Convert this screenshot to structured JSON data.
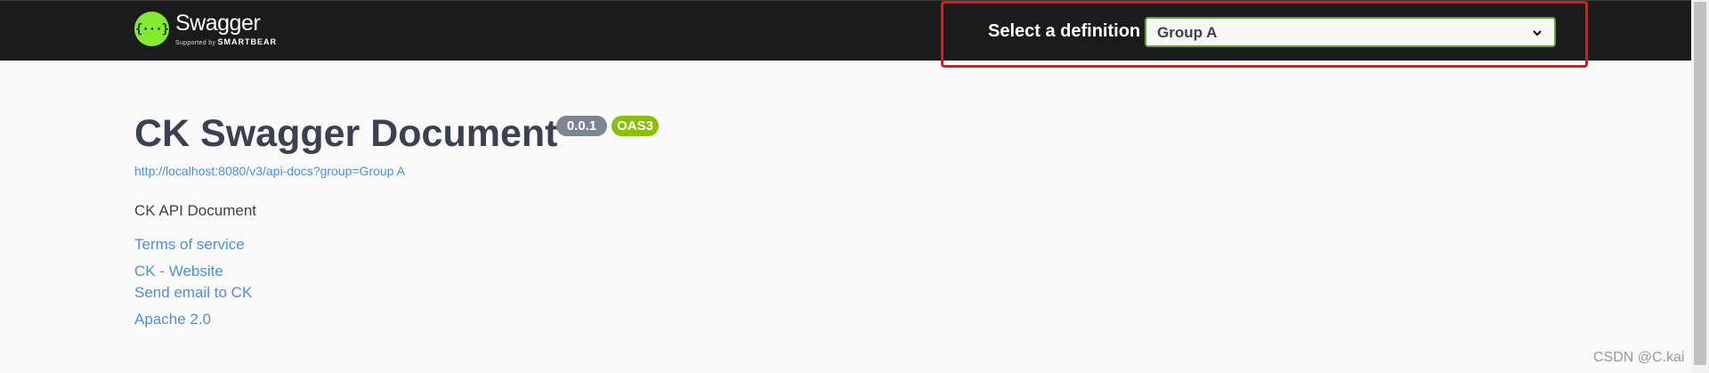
{
  "header": {
    "logo_name": "Swagger",
    "logo_supported_by": "Supported by",
    "logo_smartbear": "SMARTBEAR",
    "logo_glyph": "{···}",
    "select_label": "Select a definition",
    "selected_definition": "Group A"
  },
  "info": {
    "title": "CK Swagger Document",
    "version_badge": "0.0.1",
    "oas_badge": "OAS3",
    "spec_url": "http://localhost:8080/v3/api-docs?group=Group A",
    "description": "CK API Document",
    "links": {
      "terms": "Terms of service",
      "website": "CK - Website",
      "email": "Send email to CK",
      "license": "Apache 2.0"
    }
  },
  "watermark": "CSDN @C.kai",
  "colors": {
    "topbar_bg": "#1b1b1b",
    "logo_green": "#85ea2d",
    "select_border": "#62a03f",
    "highlight_red": "#e8141c",
    "link_blue": "#4990e2",
    "version_badge_bg": "#7d8492",
    "oas_badge_bg": "#89bf04"
  }
}
